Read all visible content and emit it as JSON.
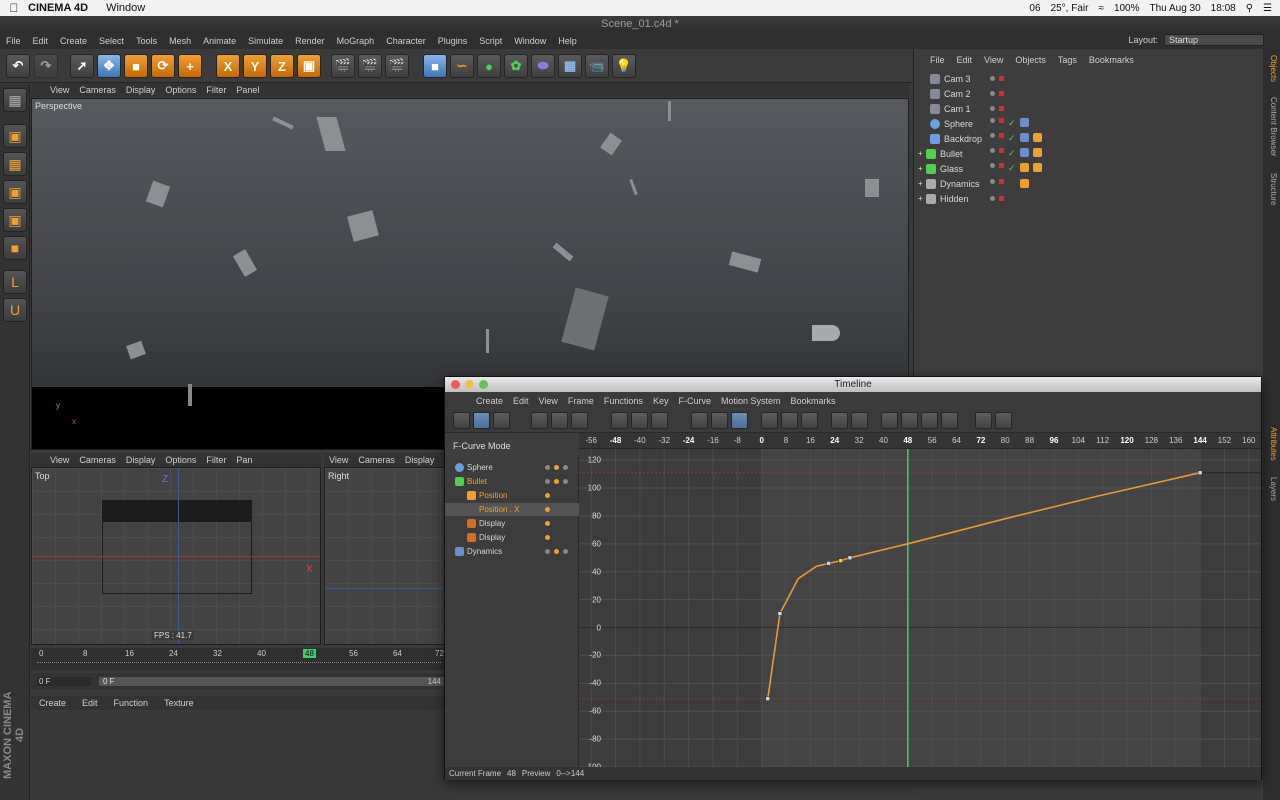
{
  "macbar": {
    "app": "CINEMA 4D",
    "menu": [
      "Window"
    ],
    "status": [
      "06",
      "25°, Fair",
      "100%",
      "Thu Aug 30",
      "18:08"
    ]
  },
  "window": {
    "title": "Scene_01.c4d *"
  },
  "menu": [
    "File",
    "Edit",
    "Create",
    "Select",
    "Tools",
    "Mesh",
    "Animate",
    "Simulate",
    "Render",
    "MoGraph",
    "Character",
    "Plugins",
    "Script",
    "Window",
    "Help"
  ],
  "layout": {
    "label": "Layout:",
    "value": "Startup"
  },
  "viewport": {
    "menu": [
      "View",
      "Cameras",
      "Display",
      "Options",
      "Filter",
      "Panel"
    ],
    "label": "Perspective"
  },
  "top_view": {
    "menu": [
      "View",
      "Cameras",
      "Display",
      "Options",
      "Filter",
      "Pan"
    ],
    "label": "Top",
    "fps": "FPS : 41.7",
    "axis_z": "Z",
    "axis_x": "X"
  },
  "right_view": {
    "menu": [
      "View",
      "Cameras",
      "Display"
    ],
    "label": "Right"
  },
  "mini_timeline": {
    "ticks": [
      "0",
      "8",
      "16",
      "24",
      "32",
      "40",
      "48",
      "56",
      "64",
      "72"
    ],
    "current": "48",
    "frame_field": "0 F",
    "range_start": "0 F",
    "range_end": "144"
  },
  "attributes": {
    "menu": [
      "Create",
      "Edit",
      "Function",
      "Texture"
    ]
  },
  "objects": {
    "menu": [
      "File",
      "Edit",
      "View",
      "Objects",
      "Tags",
      "Bookmarks"
    ],
    "items": [
      {
        "name": "Cam 3"
      },
      {
        "name": "Cam 2"
      },
      {
        "name": "Cam 1"
      },
      {
        "name": "Sphere"
      },
      {
        "name": "Backdrop"
      },
      {
        "name": "Bullet"
      },
      {
        "name": "Glass"
      },
      {
        "name": "Dynamics"
      },
      {
        "name": "Hidden"
      }
    ]
  },
  "side_tabs": [
    "Objects",
    "Content Browser",
    "Structure",
    "Attributes",
    "Layers"
  ],
  "timeline": {
    "title": "Timeline",
    "menu": [
      "Create",
      "Edit",
      "View",
      "Frame",
      "Functions",
      "Key",
      "F-Curve",
      "Motion System",
      "Bookmarks"
    ],
    "mode": "F-Curve Mode",
    "tree": [
      {
        "label": "Sphere",
        "selected": false,
        "indent": 0
      },
      {
        "label": "Bullet",
        "selected": true,
        "indent": 0
      },
      {
        "label": "Position",
        "selected": true,
        "indent": 1
      },
      {
        "label": "Position . X",
        "selected": true,
        "indent": 2
      },
      {
        "label": "Display",
        "selected": false,
        "indent": 1
      },
      {
        "label": "Display",
        "selected": false,
        "indent": 1
      },
      {
        "label": "Dynamics",
        "selected": false,
        "indent": 0
      }
    ],
    "ruler": [
      "-56",
      "-48",
      "-40",
      "-32",
      "-24",
      "-16",
      "-8",
      "0",
      "8",
      "16",
      "24",
      "32",
      "40",
      "48",
      "56",
      "64",
      "72",
      "80",
      "88",
      "96",
      "104",
      "112",
      "120",
      "128",
      "136",
      "144",
      "152",
      "160"
    ],
    "status_frame_label": "Current Frame",
    "status_frame": "48",
    "status_preview_label": "Preview",
    "status_preview": "0-->144"
  },
  "chart_data": {
    "type": "line",
    "title": "",
    "xlabel": "",
    "ylabel": "",
    "xlim": [
      -60,
      164
    ],
    "ylim": [
      -100,
      128
    ],
    "x_ticks": [
      -56,
      -48,
      -40,
      -32,
      -24,
      -16,
      -8,
      0,
      8,
      16,
      24,
      32,
      40,
      48,
      56,
      64,
      72,
      80,
      88,
      96,
      104,
      112,
      120,
      128,
      136,
      144,
      152,
      160
    ],
    "y_ticks": [
      120,
      100,
      80,
      60,
      40,
      20,
      0,
      -20,
      -40,
      -60,
      -80,
      -100
    ],
    "current_frame": 48,
    "series": [
      {
        "x": [
          2,
          6,
          12,
          18,
          22,
          26,
          29,
          48,
          80,
          110,
          144
        ],
        "y": [
          -51,
          10,
          35,
          44,
          46,
          48,
          50,
          60,
          78,
          94,
          111
        ],
        "keys_x": [
          2,
          6,
          22,
          26,
          29,
          144
        ],
        "keys_y": [
          -51,
          10,
          46,
          48,
          50,
          111
        ],
        "color": "#e89a30"
      }
    ]
  }
}
